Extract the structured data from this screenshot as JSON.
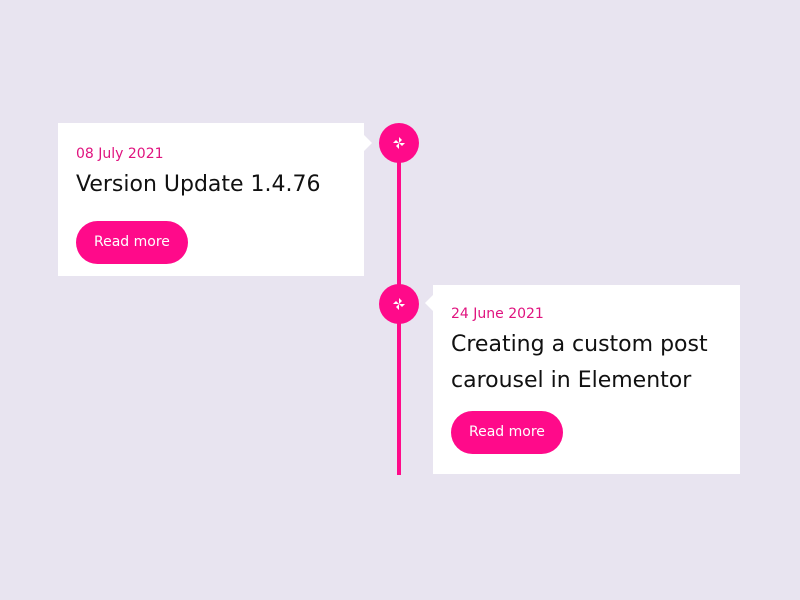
{
  "accent_color": "#ff0a8a",
  "background_color": "#e8e4f0",
  "timeline": {
    "items": [
      {
        "date": "08 July 2021",
        "title": "Version Update 1.4.76",
        "button_label": "Read more",
        "icon": "pinwheel-icon",
        "side": "left"
      },
      {
        "date": "24 June 2021",
        "title": "Creating a custom post carousel in Elementor",
        "button_label": "Read more",
        "icon": "pinwheel-icon",
        "side": "right"
      }
    ]
  }
}
